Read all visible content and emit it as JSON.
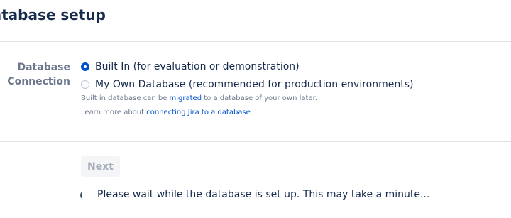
{
  "page": {
    "title": "Database setup"
  },
  "form": {
    "label_line1": "Database",
    "label_line2": "Connection",
    "options": [
      {
        "label": "Built In (for evaluation or demonstration)",
        "selected": true
      },
      {
        "label": "My Own Database (recommended for production environments)",
        "selected": false
      }
    ],
    "help1": {
      "prefix": "Built in database can be ",
      "link": "migrated",
      "suffix": " to a database of your own later."
    },
    "help2": {
      "prefix": "Learn more about ",
      "link": "connecting Jira to a database",
      "suffix": "."
    }
  },
  "actions": {
    "next_label": "Next",
    "next_enabled": false
  },
  "status": {
    "message": "Please wait while the database is set up. This may take a minute..."
  },
  "colors": {
    "accent": "#0052cc",
    "text": "#172b4d",
    "muted": "#6b778c",
    "divider": "#dfe1e6"
  }
}
